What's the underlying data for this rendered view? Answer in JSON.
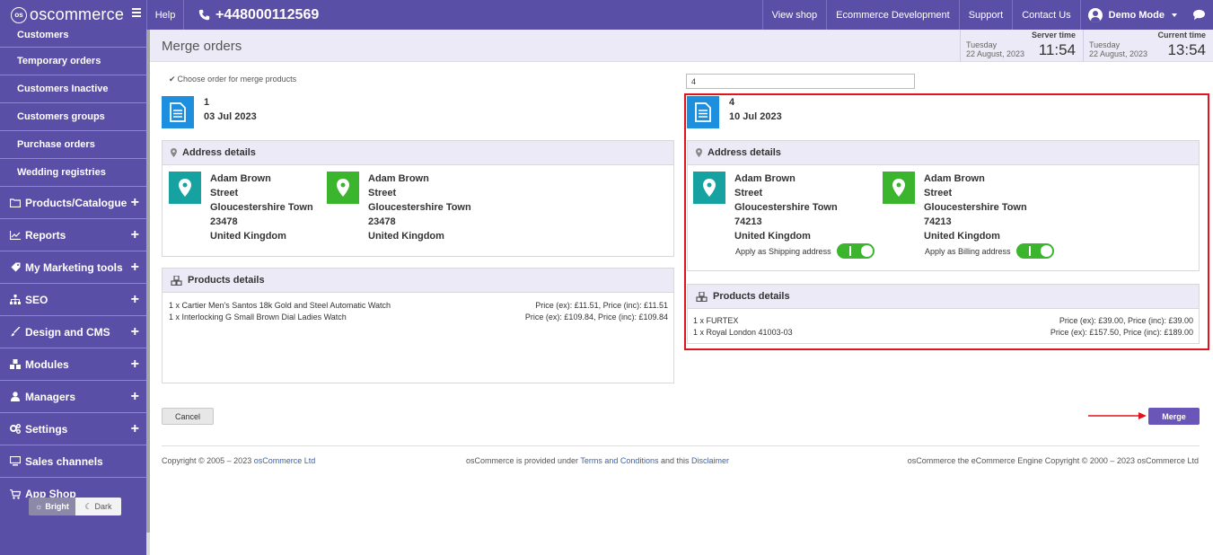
{
  "brand": {
    "logo_mark": "os",
    "name": "oscommerce"
  },
  "topbar": {
    "help": "Help",
    "phone": "+448000112569",
    "links": [
      "View shop",
      "Ecommerce Development",
      "Support",
      "Contact Us"
    ],
    "user": "Demo Mode"
  },
  "sidebar": {
    "subitems": [
      "Customers",
      "Temporary orders",
      "Customers Inactive",
      "Customers groups",
      "Purchase orders",
      "Wedding registries"
    ],
    "items": [
      {
        "label": "Products/Catalogue",
        "icon": "folder-icon"
      },
      {
        "label": "Reports",
        "icon": "chart-line-icon"
      },
      {
        "label": "My Marketing tools",
        "icon": "tag-icon"
      },
      {
        "label": "SEO",
        "icon": "sitemap-icon"
      },
      {
        "label": "Design and CMS",
        "icon": "brush-icon"
      },
      {
        "label": "Modules",
        "icon": "cubes-icon"
      },
      {
        "label": "Managers",
        "icon": "user-icon"
      },
      {
        "label": "Settings",
        "icon": "gears-icon"
      },
      {
        "label": "Sales channels",
        "icon": "monitor-icon"
      },
      {
        "label": "App Shop",
        "icon": "cart-icon"
      }
    ],
    "theme": {
      "bright": "Bright",
      "dark": "Dark"
    }
  },
  "header": {
    "title": "Merge orders",
    "server_time": {
      "label": "Server time",
      "day": "Tuesday",
      "date": "22 August, 2023",
      "time": "11:54"
    },
    "current_time": {
      "label": "Current time",
      "day": "Tuesday",
      "date": "22 August, 2023",
      "time": "13:54"
    }
  },
  "left_order": {
    "note": "Choose order for merge products",
    "number": "1",
    "date": "03 Jul 2023",
    "address_title": "Address details",
    "shipping": [
      "Adam Brown",
      "Street",
      "Gloucestershire Town",
      "23478",
      "United Kingdom"
    ],
    "billing": [
      "Adam Brown",
      "Street",
      "Gloucestershire Town",
      "23478",
      "United Kingdom"
    ],
    "products_title": "Products details",
    "products": [
      {
        "name": "1 x Cartier Men's Santos 18k Gold and Steel Automatic Watch",
        "price": "Price (ex): £11.51, Price (inc): £11.51"
      },
      {
        "name": "1 x Interlocking G Small Brown Dial Ladies Watch",
        "price": "Price (ex): £109.84, Price (inc): £109.84"
      }
    ]
  },
  "right_order": {
    "search_value": "4",
    "number": "4",
    "date": "10 Jul 2023",
    "address_title": "Address details",
    "shipping": [
      "Adam Brown",
      "Street",
      "Gloucestershire Town",
      "74213",
      "United Kingdom"
    ],
    "billing": [
      "Adam Brown",
      "Street",
      "Gloucestershire Town",
      "74213",
      "United Kingdom"
    ],
    "apply_shipping": "Apply as Shipping address",
    "apply_billing": "Apply as Billing address",
    "products_title": "Products details",
    "products": [
      {
        "name": "1 x FURTEX",
        "price": "Price (ex): £39.00, Price (inc): £39.00"
      },
      {
        "name": "1 x Royal London 41003-03",
        "price": "Price (ex): £157.50, Price (inc): £189.00"
      }
    ]
  },
  "actions": {
    "cancel": "Cancel",
    "merge": "Merge"
  },
  "footer": {
    "copyright_prefix": "Copyright © 2005 – 2023 ",
    "copyright_link": "osCommerce Ltd",
    "license_prefix": "osCommerce is provided under ",
    "terms_link": "Terms and Conditions",
    "license_mid": " and this ",
    "disclaimer_link": "Disclaimer",
    "engine": "osCommerce the eCommerce Engine Copyright © 2000 – 2023 osCommerce Ltd"
  },
  "colors": {
    "brand": "#5a4fa6",
    "accent": "#6a55b8",
    "highlight": "#e0141c",
    "doc": "#1e8fde",
    "pin_teal": "#17a2a2",
    "pin_green": "#3cb52e"
  }
}
